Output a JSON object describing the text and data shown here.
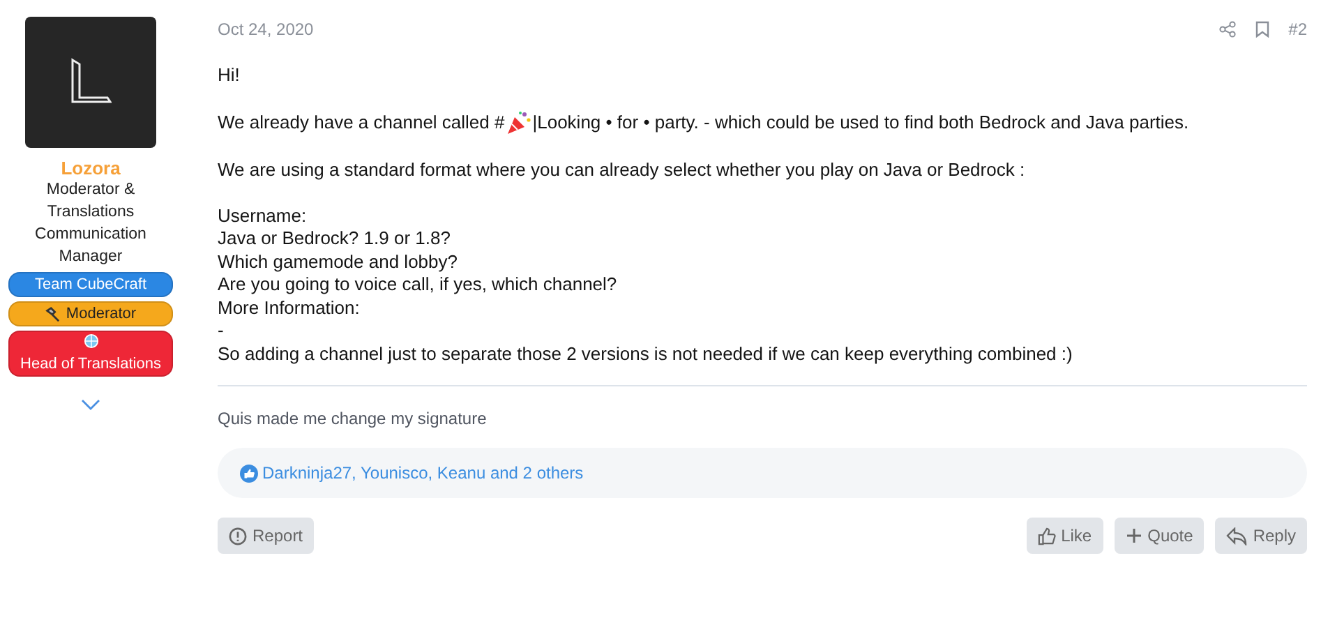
{
  "author": {
    "name": "Lozora",
    "title": "Moderator & Translations Communication Manager",
    "banners": [
      {
        "label": "Team CubeCraft",
        "kind": "plain",
        "color": "#2b87e3"
      },
      {
        "label": "Moderator",
        "kind": "hammer",
        "color": "#f5a81c"
      },
      {
        "label": "Head of Translations",
        "kind": "globe",
        "color": "#ee2737"
      }
    ]
  },
  "post": {
    "date": "Oct 24, 2020",
    "number": "#2",
    "lines": [
      {
        "text": "Hi!",
        "kind": "text"
      },
      {
        "kind": "gap"
      },
      {
        "kind": "channel",
        "before": "We already have a channel called #",
        "after": "|Looking • for • party. - which could be used to find both Bedrock and Java parties."
      },
      {
        "kind": "gap"
      },
      {
        "text": "We are using a standard format where you can already select whether you play on Java or Bedrock :",
        "kind": "text"
      },
      {
        "kind": "gap"
      },
      {
        "text": "Username:",
        "kind": "text"
      },
      {
        "text": "Java or Bedrock? 1.9 or 1.8?",
        "kind": "text"
      },
      {
        "text": "Which gamemode and lobby?",
        "kind": "text"
      },
      {
        "text": "Are you going to voice call, if yes, which channel?",
        "kind": "text"
      },
      {
        "text": "More Information:",
        "kind": "text"
      },
      {
        "text": "-",
        "kind": "text"
      },
      {
        "text": "So adding a channel just to separate those 2 versions is not needed if we can keep everything combined :)",
        "kind": "text"
      }
    ],
    "signature": "Quis made me change my signature",
    "reactions": "Darkninja27, Younisco, Keanu and 2 others",
    "actions_left": [
      {
        "label": "Report",
        "kind": "report"
      }
    ],
    "actions_right": [
      {
        "label": "Like",
        "kind": "like"
      },
      {
        "label": "Quote",
        "kind": "quote"
      },
      {
        "label": "Reply",
        "kind": "reply"
      }
    ]
  }
}
